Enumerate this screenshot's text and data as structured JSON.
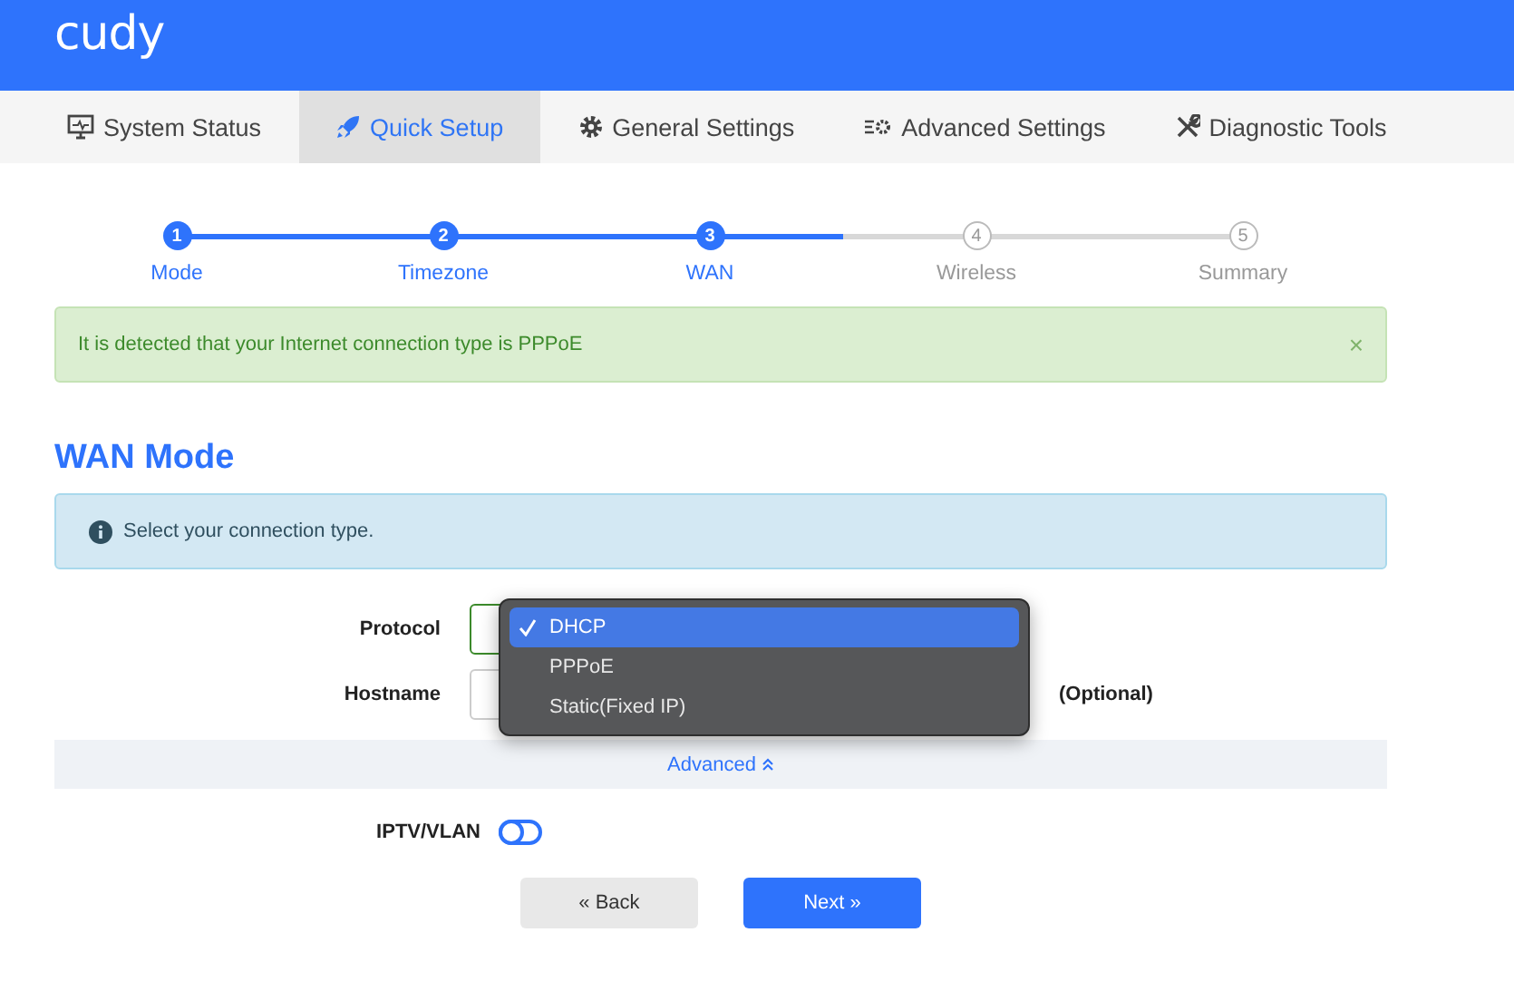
{
  "header": {
    "logo": "cudy"
  },
  "tabs": [
    {
      "label": "System Status",
      "kind": "monitor",
      "selected": false
    },
    {
      "label": "Quick Setup",
      "kind": "rocket",
      "selected": true
    },
    {
      "label": "General Settings",
      "kind": "gear",
      "selected": false
    },
    {
      "label": "Advanced Settings",
      "kind": "sliders",
      "selected": false
    },
    {
      "label": "Diagnostic Tools",
      "kind": "tools",
      "selected": false
    }
  ],
  "steps": [
    {
      "number": "1",
      "label": "Mode",
      "done": true
    },
    {
      "number": "2",
      "label": "Timezone",
      "done": true
    },
    {
      "number": "3",
      "label": "WAN",
      "done": true
    },
    {
      "number": "4",
      "label": "Wireless",
      "done": false
    },
    {
      "number": "5",
      "label": "Summary",
      "done": false
    }
  ],
  "success_alert": {
    "text": "It is detected that your Internet connection type is PPPoE",
    "close": "×"
  },
  "section_title": "WAN Mode",
  "info_alert": {
    "text": "Select your connection type."
  },
  "form": {
    "protocol_label": "Protocol",
    "hostname_label": "Hostname",
    "hostname_hint": "(Optional)"
  },
  "protocol_dropdown": [
    {
      "label": "DHCP",
      "selected": true
    },
    {
      "label": "PPPoE",
      "selected": false
    },
    {
      "label": "Static(Fixed IP)",
      "selected": false
    }
  ],
  "advanced": {
    "label": "Advanced",
    "expanded": true
  },
  "iptv": {
    "label": "IPTV/VLAN",
    "on": false
  },
  "buttons": {
    "back": "« Back",
    "next": "Next »"
  }
}
